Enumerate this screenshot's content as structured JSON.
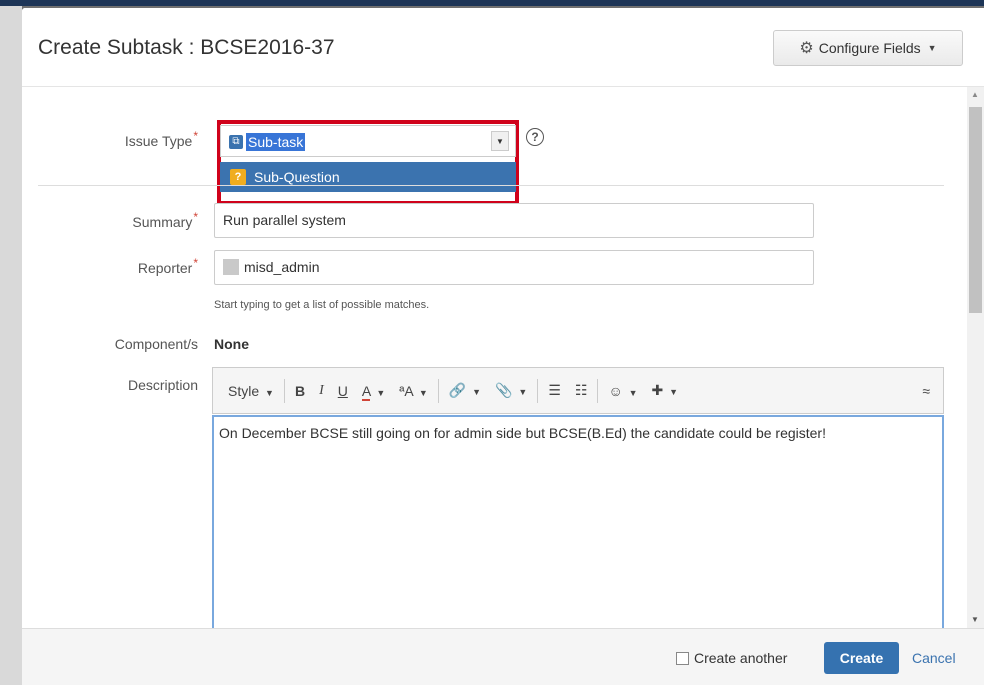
{
  "dialog": {
    "title": "Create Subtask : BCSE2016-37",
    "configure_fields_label": "Configure Fields",
    "configure_icon": "gear-icon"
  },
  "form": {
    "issue_type": {
      "label": "Issue Type",
      "required_mark": "*",
      "selected": "Sub-task",
      "options": [
        "Sub-Question"
      ]
    },
    "summary": {
      "label": "Summary",
      "required_mark": "*",
      "value": "Run parallel system"
    },
    "reporter": {
      "label": "Reporter",
      "required_mark": "*",
      "value": "misd_admin",
      "hint": "Start typing to get a list of possible matches."
    },
    "component": {
      "label": "Component/s",
      "value": "None"
    },
    "description": {
      "label": "Description",
      "text": "On December BCSE still going on for admin side but BCSE(B.Ed) the candidate could be register!",
      "toolbar": {
        "style": "Style",
        "bold": "B",
        "italic": "I",
        "underline": "U",
        "color": "A",
        "text_effects": "ªA",
        "link": "🔗",
        "attachment": "📎",
        "bullet_list": "☰",
        "numbered_list": "☷",
        "emoticon": "☺",
        "insert": "✚",
        "collapse": "≈"
      }
    }
  },
  "footer": {
    "create_another_label": "Create another",
    "create_label": "Create",
    "cancel_label": "Cancel"
  },
  "colors": {
    "primary": "#3572b0",
    "highlight_outline": "#d0021b",
    "dropdown_option_bg": "#3b73af"
  }
}
